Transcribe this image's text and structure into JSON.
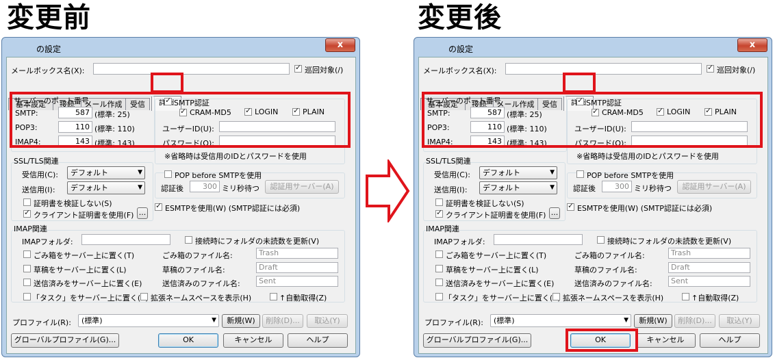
{
  "headings": {
    "before": "変更前",
    "after": "変更後"
  },
  "dialog": {
    "title": "の設定",
    "close_glyph": "x",
    "mailbox_label": "メールボックス名(X):",
    "mailbox_value": "",
    "patrol_label": "巡回対象(/)",
    "tabs": [
      "基本設定",
      "接続",
      "メール作成",
      "受信",
      "詳細"
    ],
    "active_tab": "詳細",
    "ports": {
      "legend": "サーバーのポート番号",
      "rows": [
        {
          "label": "SMTP:",
          "value": "587",
          "default": "(標準: 25)"
        },
        {
          "label": "POP3:",
          "value": "110",
          "default": "(標準: 110)"
        },
        {
          "label": "IMAP4:",
          "value": "143",
          "default": "(標準: 143)"
        }
      ]
    },
    "smtp_auth": {
      "label": "SMTP認証",
      "checked": true,
      "methods": [
        {
          "label": "CRAM-MD5",
          "checked": true
        },
        {
          "label": "LOGIN",
          "checked": true
        },
        {
          "label": "PLAIN",
          "checked": true
        }
      ],
      "userid_label": "ユーザーID(U):",
      "password_label": "パスワード(O):",
      "note": "※省略時は受信用のIDとパスワードを使用"
    },
    "ssl": {
      "legend": "SSL/TLS関連",
      "recv_label": "受信用(C):",
      "recv_value": "デフォルト",
      "send_label": "送信用(I):",
      "send_value": "デフォルト",
      "noverify_label": "証明書を検証しない(S)",
      "noverify_checked": false,
      "client_cert_label": "クライアント証明書を使用(F)",
      "client_cert_checked": true,
      "browse_label": "..."
    },
    "pop_before": {
      "label": "POP before SMTPを使用",
      "checked": false,
      "wait_label": "認証後",
      "wait_value": "300",
      "wait_unit": "ミリ秒待つ",
      "server_button": "認証用サーバー(A)"
    },
    "esmtp": {
      "label": "ESMTPを使用(W) (SMTP認証には必須)",
      "checked": true
    },
    "imap": {
      "legend": "IMAP関連",
      "folder_label": "IMAPフォルダ:",
      "folder_value": "",
      "update_unread_label": "接続時にフォルダの未読数を更新(V)",
      "update_unread_checked": false,
      "rows": [
        {
          "check": "ごみ箱をサーバー上に置く(T)",
          "file_label": "ごみ箱のファイル名:",
          "file_value": "Trash"
        },
        {
          "check": "草稿をサーバー上に置く(L)",
          "file_label": "草稿のファイル名:",
          "file_value": "Draft"
        },
        {
          "check": "送信済みをサーバー上に置く(E)",
          "file_label": "送信済みのファイル名:",
          "file_value": "Sent"
        }
      ],
      "task_label": "「タスク」をサーバー上に置く(K)",
      "namespace_label": "拡張ネームスペースを表示(H)",
      "autofetch_label": "↑自動取得(Z)"
    },
    "profile": {
      "label": "プロファイル(R):",
      "value": "(標準)",
      "new_button": "新規(W)",
      "delete_button": "削除(D)...",
      "import_button": "取込(Y)"
    },
    "buttons": {
      "global_profile": "グローバルプロファイル(G)...",
      "ok": "OK",
      "cancel": "キャンセル",
      "help": "ヘルプ"
    }
  }
}
